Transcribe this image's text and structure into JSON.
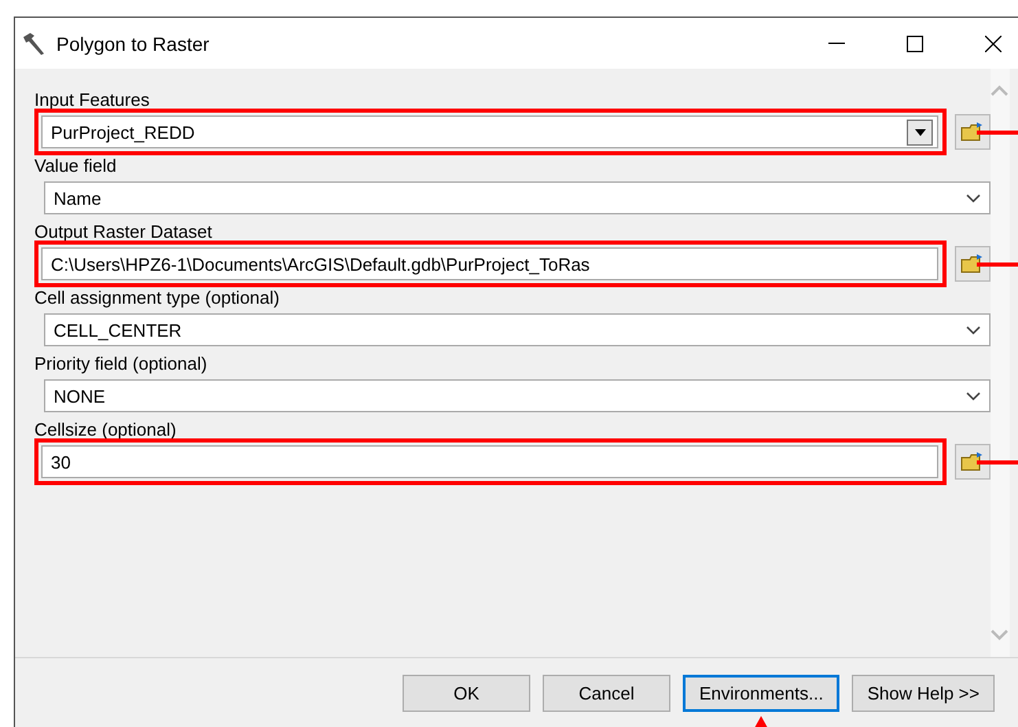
{
  "window": {
    "title": "Polygon to Raster"
  },
  "fields": [
    {
      "label": "Input Features",
      "value": "PurProject_REDD",
      "kind": "combo",
      "browse": true,
      "highlighted": true
    },
    {
      "label": "Value field",
      "value": "Name",
      "kind": "dropdown",
      "browse": false,
      "highlighted": false
    },
    {
      "label": "Output Raster Dataset",
      "value": "C:\\Users\\HPZ6-1\\Documents\\ArcGIS\\Default.gdb\\PurProject_ToRas",
      "kind": "text",
      "browse": true,
      "highlighted": true
    },
    {
      "label": "Cell assignment type (optional)",
      "value": "CELL_CENTER",
      "kind": "dropdown",
      "browse": false,
      "highlighted": false
    },
    {
      "label": "Priority field (optional)",
      "value": "NONE",
      "kind": "dropdown",
      "browse": false,
      "highlighted": false
    },
    {
      "label": "Cellsize (optional)",
      "value": "30",
      "kind": "text",
      "browse": true,
      "highlighted": true
    }
  ],
  "buttons": [
    {
      "label": "OK",
      "focused": false,
      "highlighted": false
    },
    {
      "label": "Cancel",
      "focused": false,
      "highlighted": false
    },
    {
      "label": "Environments...",
      "focused": true,
      "highlighted": true
    },
    {
      "label": "Show Help >>",
      "focused": false,
      "highlighted": false
    }
  ]
}
